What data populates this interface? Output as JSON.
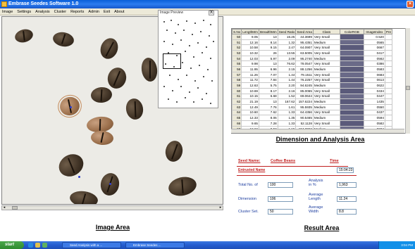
{
  "window": {
    "title": "Embrase Seedes Software 1.0"
  },
  "menu": [
    "Image",
    "Settings",
    "Analysis",
    "Cluster",
    "Reports",
    "Admin",
    "Exit",
    "About"
  ],
  "preview": {
    "label": "Image Preview",
    "close": "X"
  },
  "image_area_caption": "Image Area",
  "table": {
    "columns": [
      "S.No",
      "LengthMm",
      "BreadthMm",
      "Seed Ratio",
      "Seed Area",
      "Class",
      "ColorRGB",
      "ImageIndex",
      "Pre"
    ],
    "rows": [
      [
        "50",
        "9.05",
        "13",
        "16.25",
        "44.3699",
        "Very Small",
        "",
        "0.520"
      ],
      [
        "51",
        "12.16",
        "8.14",
        "1.32",
        "95.4351",
        "Medium",
        "",
        "0565"
      ],
      [
        "52",
        "10.58",
        "9.15",
        "2.47",
        "64.0907",
        "Very Small",
        "",
        "0667"
      ],
      [
        "53",
        "10.32",
        "26",
        "13.55",
        "63.5005",
        "Very Small",
        "",
        "0417"
      ],
      [
        "54",
        "12.03",
        "5.97",
        "2.09",
        "95.2740",
        "Medium",
        "",
        "0562"
      ],
      [
        "55",
        "9.98",
        "13",
        "76.62",
        "78.0547",
        "Very Small",
        "",
        "0386"
      ],
      [
        "56",
        "11.95",
        "6.96",
        "2.15",
        "88.1256",
        "Medium",
        "",
        "0583"
      ],
      [
        "57",
        "11.26",
        "7.07",
        "1.44",
        "79.1511",
        "Very Small",
        "",
        "0683"
      ],
      [
        "58",
        "11.72",
        "7.84",
        "1.44",
        "76.2257",
        "Very Small",
        "",
        "0613"
      ],
      [
        "59",
        "12.63",
        "5.75",
        "2.20",
        "94.6245",
        "Medium",
        "",
        "0622"
      ],
      [
        "60",
        "10.69",
        "8.17",
        "2.16",
        "85.0065",
        "Very Small",
        "",
        "0434"
      ],
      [
        "61",
        "10.15",
        "6.68",
        "1.52",
        "69.0644",
        "Very Small",
        "",
        "0447"
      ],
      [
        "62",
        "21.19",
        "13",
        "167.62",
        "157.6224",
        "Medium",
        "",
        "1435"
      ],
      [
        "63",
        "12.49",
        "7.76",
        "1.61",
        "95.5935",
        "Medium",
        "",
        "0550"
      ],
      [
        "64",
        "10.60",
        "7.62",
        "1.33",
        "64.4356",
        "Very Small",
        "",
        "0437"
      ],
      [
        "65",
        "12.33",
        "8.06",
        "1.35",
        "90.5465",
        "Medium",
        "",
        "0594"
      ],
      [
        "66",
        "9.65",
        "7.28",
        "1.33",
        "52.1128",
        "Very Small",
        "",
        "0582"
      ],
      [
        "67",
        "12.62",
        "8.52",
        "1.15",
        "104.3062",
        "Medium",
        "",
        "0604"
      ]
    ]
  },
  "dimension_caption": "Dimension and Analysis Area",
  "result": {
    "seed_name_label": "Seed Name:",
    "seed_name_value": "Coffee Beans",
    "time_label": "Time",
    "time_value": "15:04:23",
    "entrust_label": "Entrusted Name",
    "total_label": "Total No. of",
    "total_value": "100",
    "analysis_label": "Analysis\nin %",
    "analysis_value": "1,963",
    "dimension_label": "Dimension",
    "dimension_value": "106",
    "avg_length_label": "Average\nLength",
    "avg_length_value": "11.24",
    "cluster_label": "Cluster Set.",
    "cluster_value": "50",
    "avg_width_label": "Average\nWidth",
    "avg_width_value": "8.8"
  },
  "result_caption": "Result Area",
  "taskbar": {
    "start": "start",
    "task1": "Seed Analysis with a ...",
    "task2": "Embrase Seedes ...",
    "clock": "3:04 PM"
  }
}
